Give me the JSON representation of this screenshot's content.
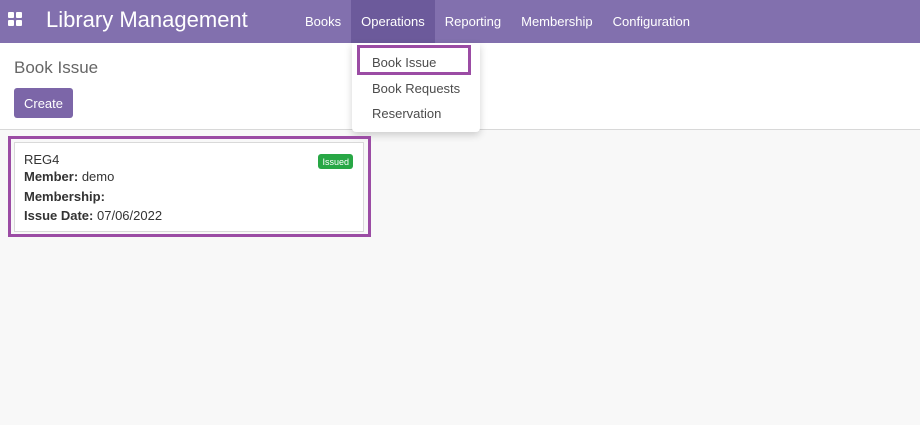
{
  "app": {
    "title": "Library Management"
  },
  "menu": {
    "items": [
      "Books",
      "Operations",
      "Reporting",
      "Membership",
      "Configuration"
    ]
  },
  "dropdown": {
    "items": [
      "Book Issue",
      "Book Requests",
      "Reservation"
    ]
  },
  "page": {
    "title": "Book Issue",
    "create_label": "Create"
  },
  "card": {
    "title": "REG4",
    "status": "Issued",
    "member_label": "Member:",
    "member_value": "demo",
    "membership_label": "Membership:",
    "membership_value": "",
    "issue_date_label": "Issue Date:",
    "issue_date_value": "07/06/2022"
  },
  "colors": {
    "navbar": "#8270ae",
    "accent": "#7c66a8",
    "highlight": "#9b4ca4",
    "status_green": "#28a745"
  }
}
